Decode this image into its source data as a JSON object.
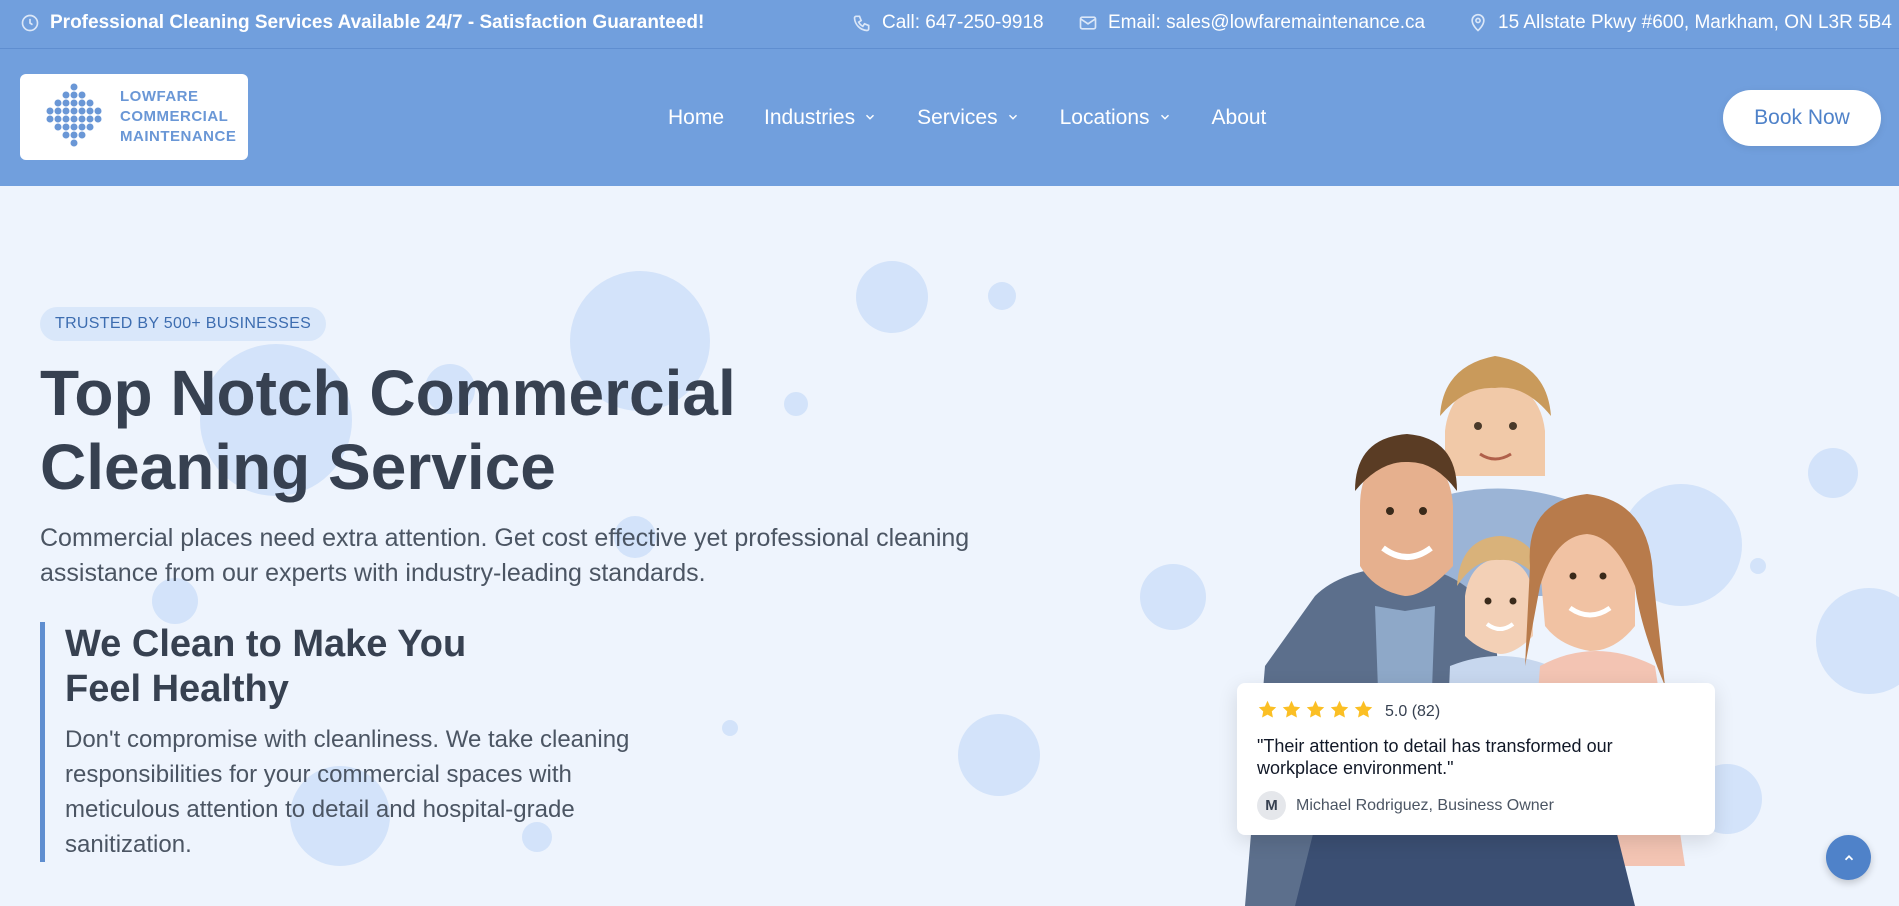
{
  "topbar": {
    "announcement": "Professional Cleaning Services Available 24/7 - Satisfaction Guaranteed!",
    "phone": "Call: 647-250-9918",
    "email": "Email: sales@lowfaremaintenance.ca",
    "address": "15 Allstate Pkwy #600, Markham, ON L3R 5B4",
    "icons": [
      "clock-icon",
      "phone-icon",
      "mail-icon",
      "map-pin-icon"
    ]
  },
  "logo": {
    "line1": "LOWFARE",
    "line2": "COMMERCIAL",
    "line3": "MAINTENANCE"
  },
  "nav": {
    "items": [
      {
        "label": "Home",
        "dropdown": false
      },
      {
        "label": "Industries",
        "dropdown": true
      },
      {
        "label": "Services",
        "dropdown": true
      },
      {
        "label": "Locations",
        "dropdown": true
      },
      {
        "label": "About",
        "dropdown": false
      }
    ],
    "cta": "Book Now"
  },
  "hero": {
    "badge": "TRUSTED BY 500+ BUSINESSES",
    "title_line1": "Top Notch Commercial",
    "title_line2": "Cleaning Service",
    "subtitle": "Commercial places need extra attention. Get cost effective yet professional cleaning assistance from our experts with industry-leading standards.",
    "feature_heading_line1": "We Clean to Make You",
    "feature_heading_line2": "Feel Healthy",
    "feature_text": "Don't compromise with cleanliness. We take cleaning responsibilities for your commercial spaces with meticulous attention to detail and hospital-grade sanitization."
  },
  "review": {
    "stars": 5,
    "rating": "5.0 (82)",
    "quote": "\"Their attention to detail has transformed our workplace environment.\"",
    "avatar_initial": "M",
    "reviewer": "Michael Rodriguez, Business Owner"
  },
  "colors": {
    "brand": "#719fdd",
    "accent": "#4f82c9",
    "heading": "#374151",
    "star": "#fbbf24",
    "background": "#eef4fd"
  }
}
